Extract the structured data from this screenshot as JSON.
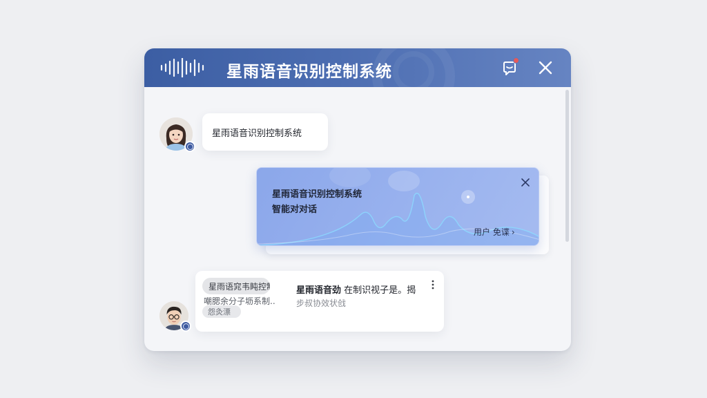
{
  "window": {
    "title": "星雨语音识别控制系统",
    "notification_badge": true
  },
  "messages": {
    "user_bubble": "星雨语音识别控制系统",
    "card": {
      "line1": "星雨语音识别控制系统",
      "line2": "智能对对话",
      "link_label": "用户 免费 ›",
      "link_text": "用户 免谍",
      "link_chevron": "›"
    },
    "agent_bubble": {
      "tag1": "星雨语窕韦盹控制",
      "tag2": "嘲腮余分子坜系制..",
      "tag3": "怨灸漂",
      "title_bold": "星雨语音劲",
      "title_rest": " 在制识视子是。揭",
      "subtitle": "步叔协效状戗"
    }
  },
  "colors": {
    "titlebar": "#3c5ea3",
    "card": "#8ba7ea",
    "badge": "#e55a5a",
    "status_ring": "#3d5aa0"
  }
}
